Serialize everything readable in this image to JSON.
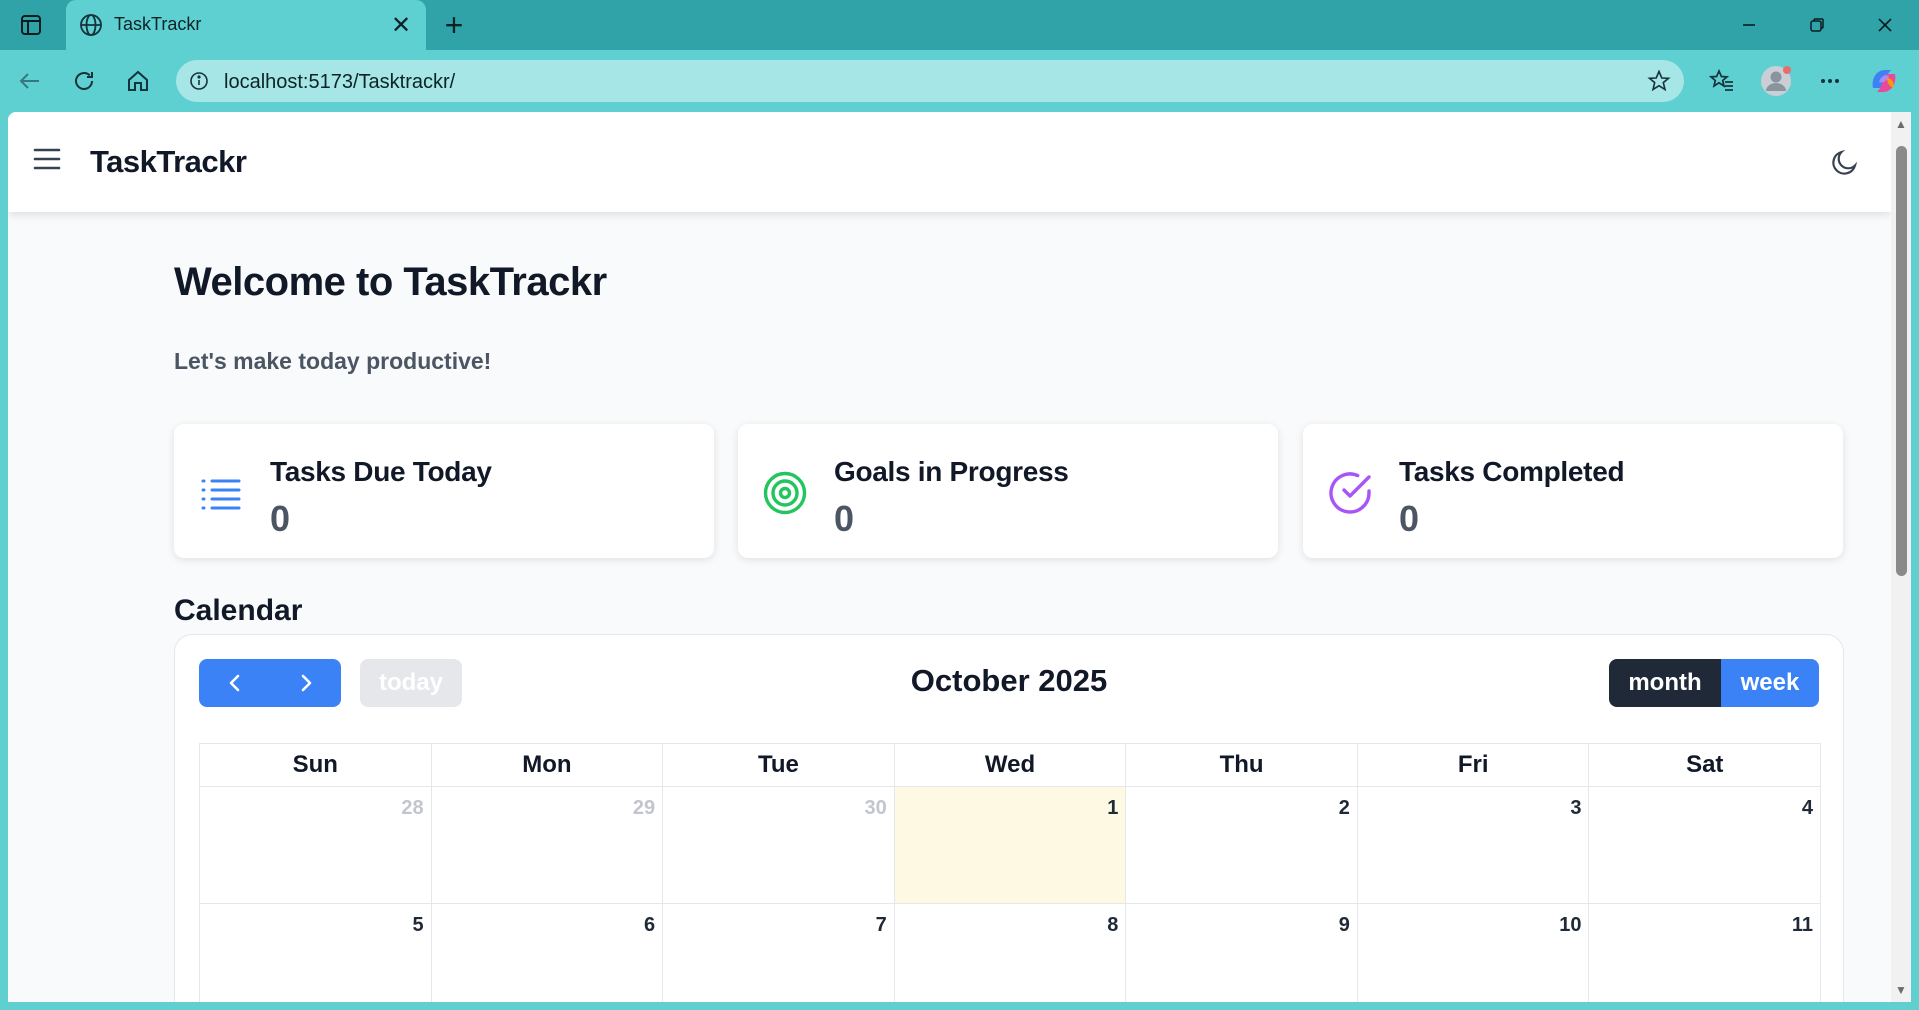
{
  "browser": {
    "tab_title": "TaskTrackr",
    "url": "localhost:5173/Tasktrackr/"
  },
  "app": {
    "brand": "TaskTrackr",
    "welcome": "Welcome to TaskTrackr",
    "subtitle": "Let's make today productive!"
  },
  "cards": [
    {
      "title": "Tasks Due Today",
      "value": "0",
      "icon": "list-icon",
      "color": "#3b82f6"
    },
    {
      "title": "Goals in Progress",
      "value": "0",
      "icon": "target-icon",
      "color": "#22c55e"
    },
    {
      "title": "Tasks Completed",
      "value": "0",
      "icon": "check-circle-icon",
      "color": "#a855f7"
    }
  ],
  "calendar": {
    "heading": "Calendar",
    "title": "October 2025",
    "today_label": "today",
    "view_month": "month",
    "view_week": "week",
    "weekdays": [
      "Sun",
      "Mon",
      "Tue",
      "Wed",
      "Thu",
      "Fri",
      "Sat"
    ],
    "weeks": [
      [
        "28",
        "29",
        "30",
        "1",
        "2",
        "3",
        "4"
      ],
      [
        "5",
        "6",
        "7",
        "8",
        "9",
        "10",
        "11"
      ]
    ],
    "today_date": "1"
  },
  "colors": {
    "primary": "#3b82f6",
    "dark_button": "#1f2937",
    "today_highlight": "#fef9e3",
    "browser_frame": "#2fa3a8"
  }
}
